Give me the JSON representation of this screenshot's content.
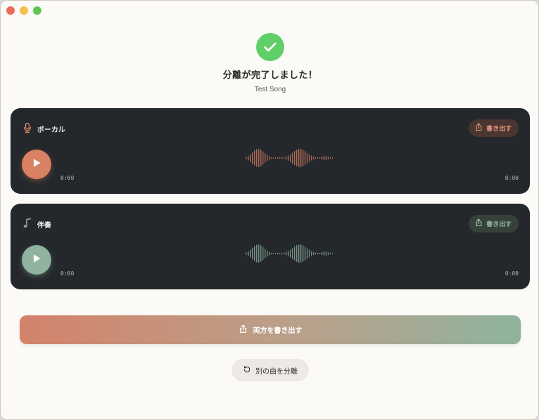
{
  "result": {
    "headline": "分離が完了しました！",
    "song_name": "Test Song"
  },
  "tracks": [
    {
      "label": "ボーカル",
      "icon": "microphone-icon",
      "export_label": "書き出す",
      "current_time": "0:00",
      "duration": "0:00",
      "accent": "#d98263"
    },
    {
      "label": "伴奏",
      "icon": "music-note-icon",
      "export_label": "書き出す",
      "current_time": "0:00",
      "duration": "0:00",
      "accent": "#8fb39e"
    }
  ],
  "actions": {
    "export_both_label": "両方を書き出す",
    "separate_another_label": "別の曲を分離"
  },
  "colors": {
    "success": "#5fcf67",
    "card_bg": "#24282c",
    "vocal_accent": "#d98263",
    "instrumental_accent": "#8fb39e"
  }
}
